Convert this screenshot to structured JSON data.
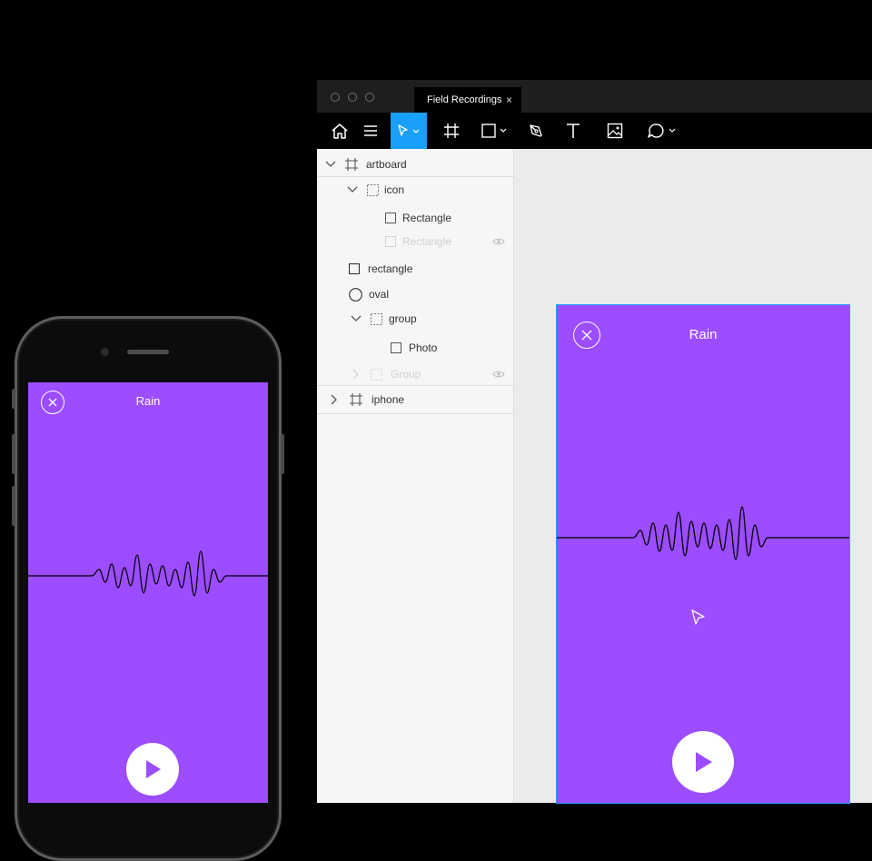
{
  "window": {
    "tab_title": "Field Recordings",
    "tab_close": "×"
  },
  "toolbar": {
    "tools": [
      "home-icon",
      "menu-icon",
      "move-tool-icon",
      "frame-tool-icon",
      "rectangle-tool-icon",
      "pen-tool-icon",
      "text-tool-icon",
      "image-tool-icon",
      "comment-tool-icon"
    ],
    "active_tool": "move-tool-icon",
    "accent": "#18a0fb"
  },
  "layers": [
    {
      "label": "artboard",
      "type": "frame",
      "expanded": true
    },
    {
      "label": "icon",
      "type": "group",
      "expanded": true
    },
    {
      "label": "Rectangle",
      "type": "rectangle"
    },
    {
      "label": "Rectangle",
      "type": "rectangle",
      "hidden": true
    },
    {
      "label": "rectangle",
      "type": "rectangle"
    },
    {
      "label": "oval",
      "type": "ellipse"
    },
    {
      "label": "group",
      "type": "group",
      "expanded": true
    },
    {
      "label": "Photo",
      "type": "rectangle"
    },
    {
      "label": "Group",
      "type": "group",
      "hidden": true
    },
    {
      "label": "iphone",
      "type": "frame",
      "expanded": false
    }
  ],
  "phone_screen": {
    "title": "Rain",
    "bg": "#9b4dff"
  },
  "artboard_screen": {
    "title": "Rain",
    "bg": "#9b4dff"
  }
}
